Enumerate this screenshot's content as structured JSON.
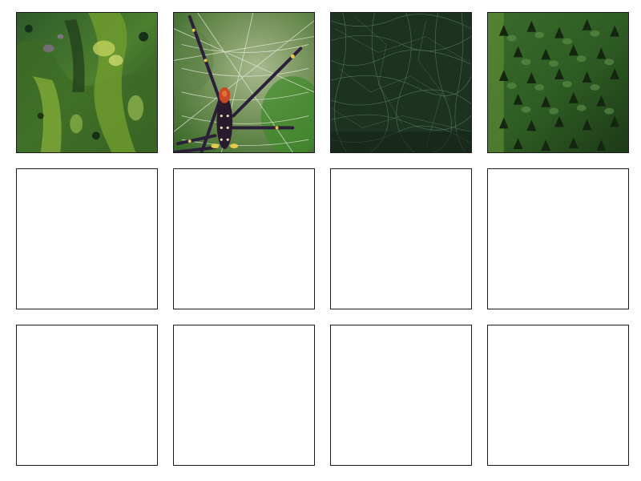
{
  "grid": {
    "rows": 3,
    "columns": 4,
    "tiles": [
      {
        "kind": "image",
        "subject": "moss-texture"
      },
      {
        "kind": "image",
        "subject": "spider-on-web"
      },
      {
        "kind": "image",
        "subject": "dark-green-fiber-texture"
      },
      {
        "kind": "image",
        "subject": "green-spiky-surface"
      },
      {
        "kind": "empty"
      },
      {
        "kind": "empty"
      },
      {
        "kind": "empty"
      },
      {
        "kind": "empty"
      },
      {
        "kind": "empty"
      },
      {
        "kind": "empty"
      },
      {
        "kind": "empty"
      },
      {
        "kind": "empty"
      }
    ]
  },
  "colors": {
    "tile_border": "#1a1a1a",
    "empty_tile": "#ffffff",
    "background": "#ffffff"
  }
}
